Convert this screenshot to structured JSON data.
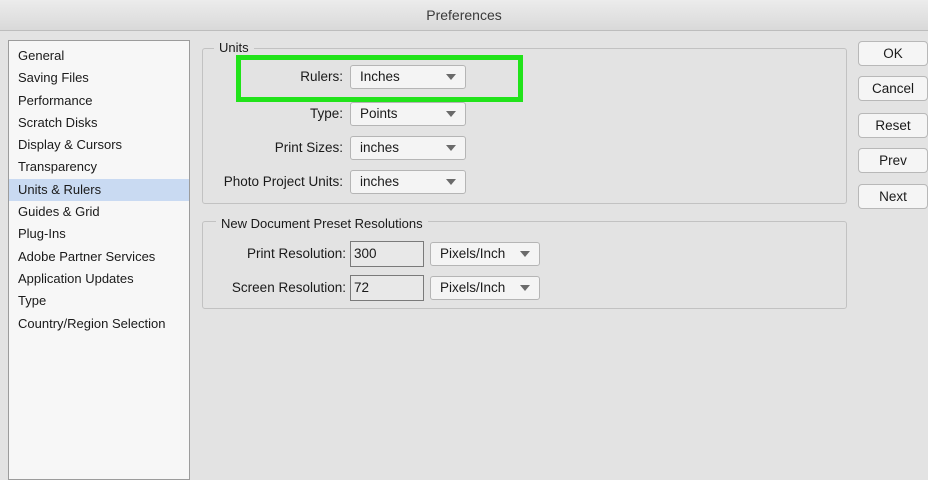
{
  "window": {
    "title": "Preferences"
  },
  "sidebar": {
    "items": [
      {
        "label": "General"
      },
      {
        "label": "Saving Files"
      },
      {
        "label": "Performance"
      },
      {
        "label": "Scratch Disks"
      },
      {
        "label": "Display & Cursors"
      },
      {
        "label": "Transparency"
      },
      {
        "label": "Units & Rulers",
        "selected": true
      },
      {
        "label": "Guides & Grid"
      },
      {
        "label": "Plug-Ins"
      },
      {
        "label": "Adobe Partner Services"
      },
      {
        "label": "Application Updates"
      },
      {
        "label": "Type"
      },
      {
        "label": "Country/Region Selection"
      }
    ]
  },
  "units": {
    "title": "Units",
    "rulers": {
      "label": "Rulers:",
      "value": "Inches"
    },
    "type": {
      "label": "Type:",
      "value": "Points"
    },
    "print_sizes": {
      "label": "Print Sizes:",
      "value": "inches"
    },
    "photo_project_units": {
      "label": "Photo Project Units:",
      "value": "inches"
    }
  },
  "resolutions": {
    "title": "New Document Preset Resolutions",
    "print": {
      "label": "Print Resolution:",
      "value": "300",
      "unit": "Pixels/Inch"
    },
    "screen": {
      "label": "Screen Resolution:",
      "value": "72",
      "unit": "Pixels/Inch"
    }
  },
  "buttons": {
    "ok": "OK",
    "cancel": "Cancel",
    "reset": "Reset",
    "prev": "Prev",
    "next": "Next"
  },
  "colors": {
    "highlight": "#21e31a",
    "selection": "#c9daf2"
  }
}
